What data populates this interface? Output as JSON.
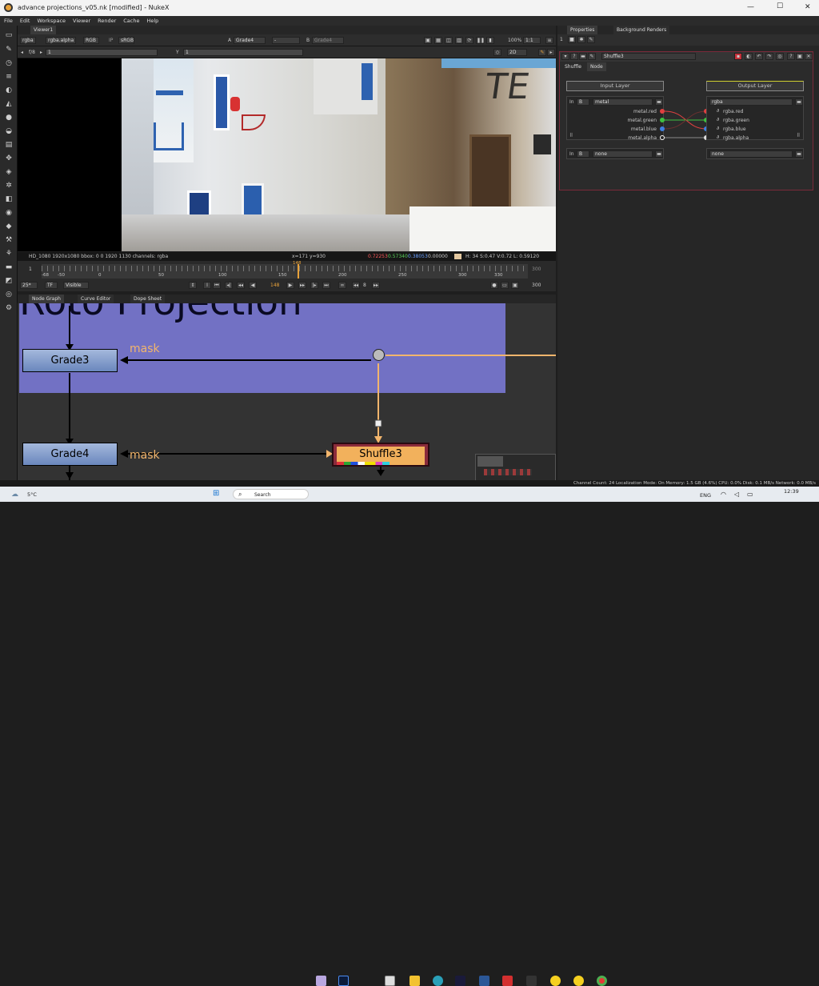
{
  "window": {
    "title": "advance projections_v05.nk [modified] - NukeX",
    "controls": [
      "—",
      "☐",
      "✕"
    ]
  },
  "menu": [
    "File",
    "Edit",
    "Workspace",
    "Viewer",
    "Render",
    "Cache",
    "Help"
  ],
  "viewer": {
    "tab": "Viewer1",
    "channels": "rgba",
    "alpha": "rgba.alpha",
    "colorspace": "RGB",
    "ip": "IP",
    "lut": "sRGB",
    "a_label": "A",
    "a_input": "Grade4",
    "dash": "-",
    "b_label": "B",
    "b_input": "Grade4",
    "zoom": "100%",
    "ratio": "1:1",
    "fstop": "f/8",
    "gain": "1",
    "y_label": "Y",
    "gamma": "1",
    "mode": "2D",
    "status_left": "HD_1080 1920x1080  bbox: 0 0 1920 1130 channels: rgba",
    "coords": "x=171 y=930",
    "pix_r": "0.72253",
    "pix_g": "0.57340",
    "pix_b": "0.38053",
    "pix_a": "0.00000",
    "hsvl": "H: 34 S:0.47 V:0.72  L: 0.59120",
    "overlay_text": "TE"
  },
  "timeline": {
    "start": "1",
    "end": "300",
    "current": "148",
    "ticks": [
      "-68",
      "-50",
      "0",
      "50",
      "100",
      "150",
      "200",
      "250",
      "300",
      "330"
    ],
    "fps": "25*",
    "tf": "TF",
    "visible": "Visible",
    "step": "8",
    "end_frame": "300"
  },
  "bottom_tabs": [
    "Node Graph",
    "Curve Editor",
    "Dope Sheet"
  ],
  "node_graph": {
    "backdrop_label": "Roto Projection",
    "nodes": [
      "Grade3",
      "Grade4",
      "Shuffle3"
    ],
    "mask1": "mask",
    "mask2": "mask"
  },
  "properties": {
    "tabs": [
      "Properties",
      "Background Renders"
    ],
    "count": "1",
    "node_name": "Shuffle3",
    "subtabs": [
      "Shuffle",
      "Node"
    ],
    "input_header": "Input Layer",
    "output_header": "Output Layer",
    "in_label": "In",
    "in_b": "B",
    "in_layer": "metal",
    "out_layer": "rgba",
    "in_channels": [
      "metal.red",
      "metal.green",
      "metal.blue",
      "metal.alpha"
    ],
    "out_channels": [
      "rgba.red",
      "rgba.green",
      "rgba.blue",
      "rgba.alpha"
    ],
    "in2_label": "In",
    "in2_b": "B",
    "in2_layer": "none",
    "out2_layer": "none",
    "colors": {
      "red": "#e04040",
      "green": "#3fc040",
      "blue": "#3f7fe0",
      "alpha": "#ffffff"
    }
  },
  "status_bar": "Channel Count: 24  Localization Mode: On  Memory: 1.5 GB (4.6%)  CPU: 0.0%  Disk: 0.1 MB/s  Network: 0.0 MB/s",
  "taskbar": {
    "weather": "5°C",
    "search": "Search",
    "lang": "ENG",
    "time": "12:39"
  }
}
